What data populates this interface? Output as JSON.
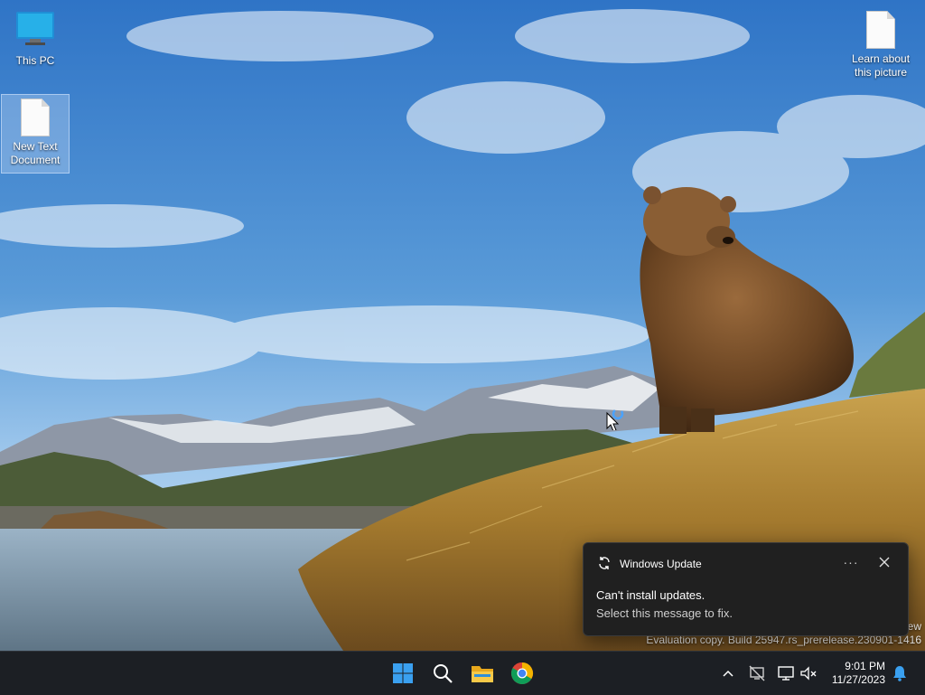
{
  "desktop": {
    "icons": [
      {
        "label": "This PC",
        "icon": "monitor-icon"
      },
      {
        "label": "New Text Document",
        "icon": "text-file-icon"
      },
      {
        "label": "Learn about this picture",
        "icon": "file-icon"
      }
    ],
    "watermark_line1": "ew",
    "watermark_line2": "Evaluation copy. Build 25947.rs_prerelease.230901-1416"
  },
  "toast": {
    "app": "Windows Update",
    "title": "Can't install updates.",
    "body": "Select this message to fix.",
    "more_label": "···"
  },
  "taskbar": {
    "items": [
      "start-icon",
      "search-icon",
      "file-explorer-icon",
      "chrome-icon"
    ],
    "tray": [
      "chevron-up-icon",
      "network-disconnected-icon",
      "display-icon",
      "volume-muted-icon",
      "bell-icon"
    ],
    "time": "9:01 PM",
    "date": "11/27/2023"
  },
  "colors": {
    "taskbar": "#1c1f24",
    "toast_bg": "#202020",
    "accent": "#1e90ff",
    "sky": "#3d7fc8"
  }
}
